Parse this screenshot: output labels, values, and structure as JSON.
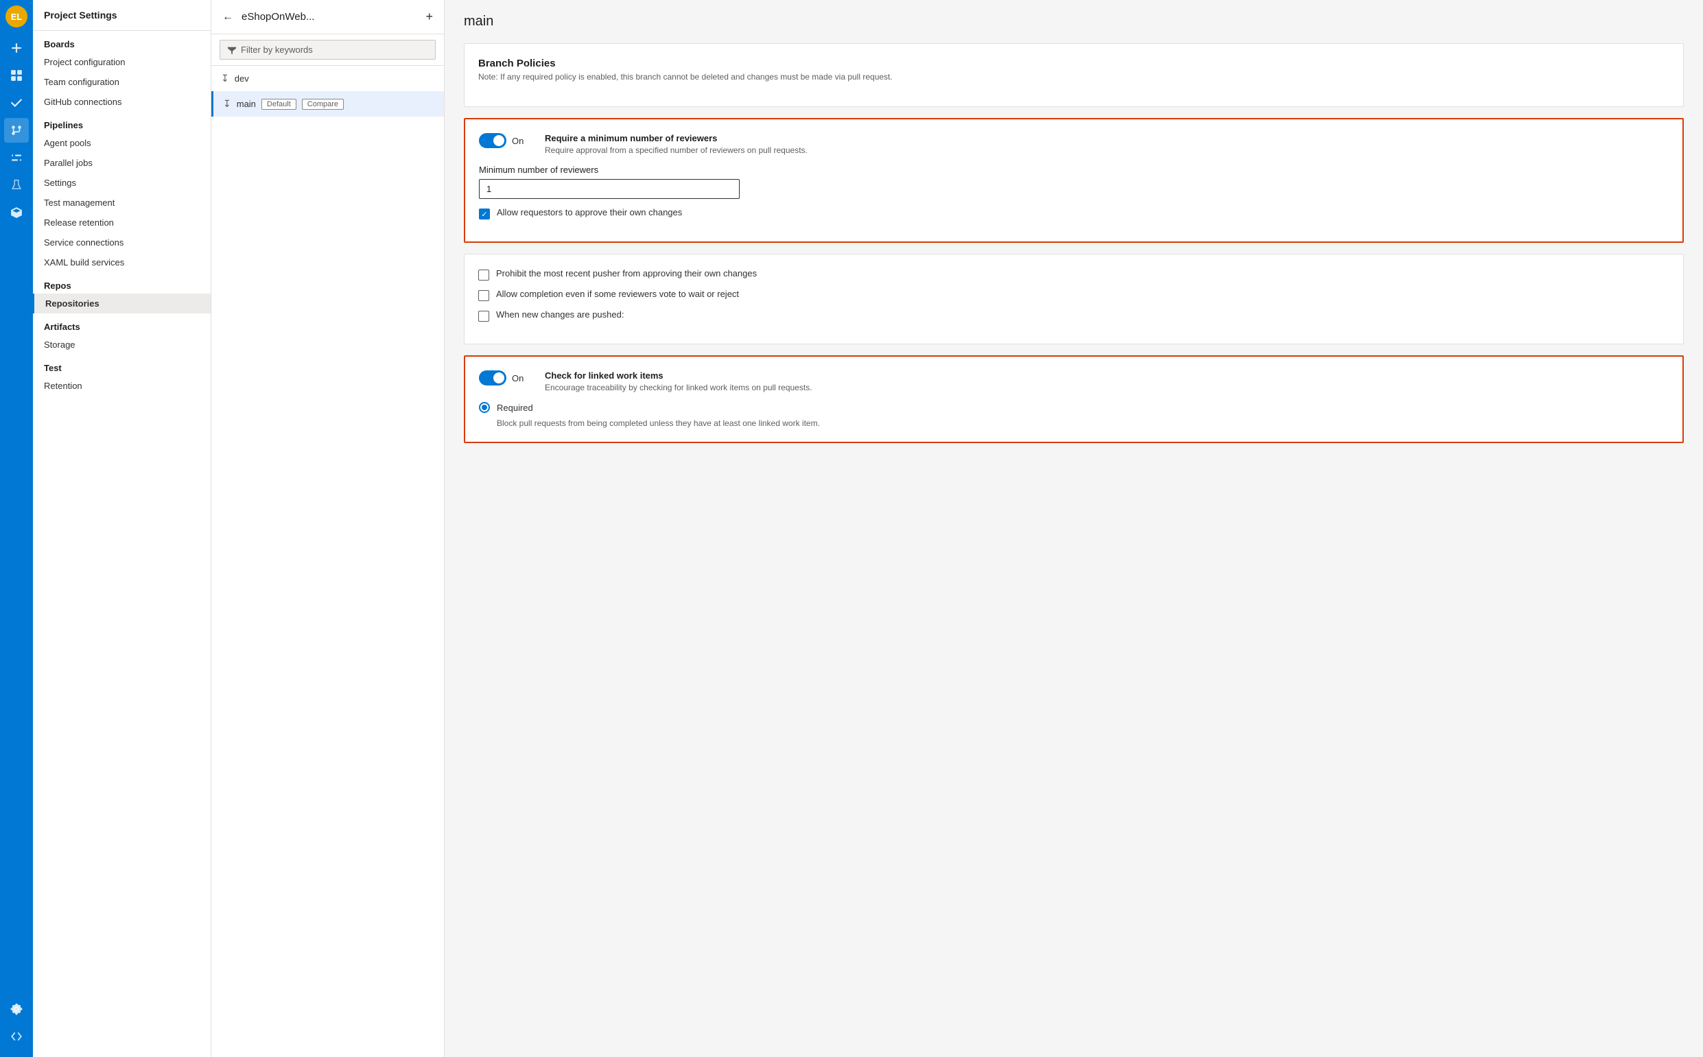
{
  "iconBar": {
    "avatar": "EL",
    "icons": [
      {
        "name": "plus-icon",
        "symbol": "+",
        "active": false
      },
      {
        "name": "boards-icon",
        "symbol": "⊞",
        "active": false
      },
      {
        "name": "checkmark-icon",
        "symbol": "✓",
        "active": false
      },
      {
        "name": "git-icon",
        "symbol": "⎇",
        "active": true
      },
      {
        "name": "pipelines-icon",
        "symbol": "▶",
        "active": false
      },
      {
        "name": "flask-icon",
        "symbol": "⚗",
        "active": false
      },
      {
        "name": "artifact-icon",
        "symbol": "📦",
        "active": false
      }
    ],
    "bottomIcons": [
      {
        "name": "settings-icon",
        "symbol": "⚙"
      },
      {
        "name": "expand-icon",
        "symbol": "»"
      }
    ]
  },
  "sidebar": {
    "title": "Project Settings",
    "sections": [
      {
        "header": "Boards",
        "items": [
          {
            "label": "Project configuration",
            "active": false
          },
          {
            "label": "Team configuration",
            "active": false
          },
          {
            "label": "GitHub connections",
            "active": false
          }
        ]
      },
      {
        "header": "Pipelines",
        "items": [
          {
            "label": "Agent pools",
            "active": false
          },
          {
            "label": "Parallel jobs",
            "active": false
          },
          {
            "label": "Settings",
            "active": false
          },
          {
            "label": "Test management",
            "active": false
          },
          {
            "label": "Release retention",
            "active": false
          },
          {
            "label": "Service connections",
            "active": false
          },
          {
            "label": "XAML build services",
            "active": false
          }
        ]
      },
      {
        "header": "Repos",
        "items": [
          {
            "label": "Repositories",
            "active": true
          }
        ]
      },
      {
        "header": "Artifacts",
        "items": [
          {
            "label": "Storage",
            "active": false
          }
        ]
      },
      {
        "header": "Test",
        "items": [
          {
            "label": "Retention",
            "active": false
          }
        ]
      }
    ]
  },
  "middlePanel": {
    "title": "eShopOnWeb...",
    "filterPlaceholder": "Filter by keywords",
    "branches": [
      {
        "name": "dev",
        "tags": [],
        "active": false
      },
      {
        "name": "main",
        "tags": [
          "Default",
          "Compare"
        ],
        "active": true
      }
    ]
  },
  "mainContent": {
    "pageTitle": "main",
    "branchPoliciesTitle": "Branch Policies",
    "branchPoliciesNote": "Note: If any required policy is enabled, this branch cannot be deleted and changes must be made via pull request.",
    "policies": [
      {
        "id": "min-reviewers",
        "toggleOn": true,
        "toggleLabel": "On",
        "title": "Require a minimum number of reviewers",
        "description": "Require approval from a specified number of reviewers on pull requests.",
        "highlighted": true,
        "subSections": [
          {
            "type": "input",
            "label": "Minimum number of reviewers",
            "value": "1"
          },
          {
            "type": "checkbox",
            "checked": true,
            "label": "Allow requestors to approve their own changes"
          }
        ]
      }
    ],
    "checkboxPolicies": [
      {
        "id": "prohibit-pusher",
        "checked": false,
        "label": "Prohibit the most recent pusher from approving their own changes"
      },
      {
        "id": "allow-completion",
        "checked": false,
        "label": "Allow completion even if some reviewers vote to wait or reject"
      },
      {
        "id": "new-changes",
        "checked": false,
        "label": "When new changes are pushed:"
      }
    ],
    "linkedWorkItems": {
      "toggleOn": true,
      "toggleLabel": "On",
      "title": "Check for linked work items",
      "description": "Encourage traceability by checking for linked work items on pull requests.",
      "highlighted": true,
      "radioOption": {
        "selected": true,
        "label": "Required"
      },
      "radioNote": "Block pull requests from being completed unless they have at least one linked work item."
    }
  }
}
